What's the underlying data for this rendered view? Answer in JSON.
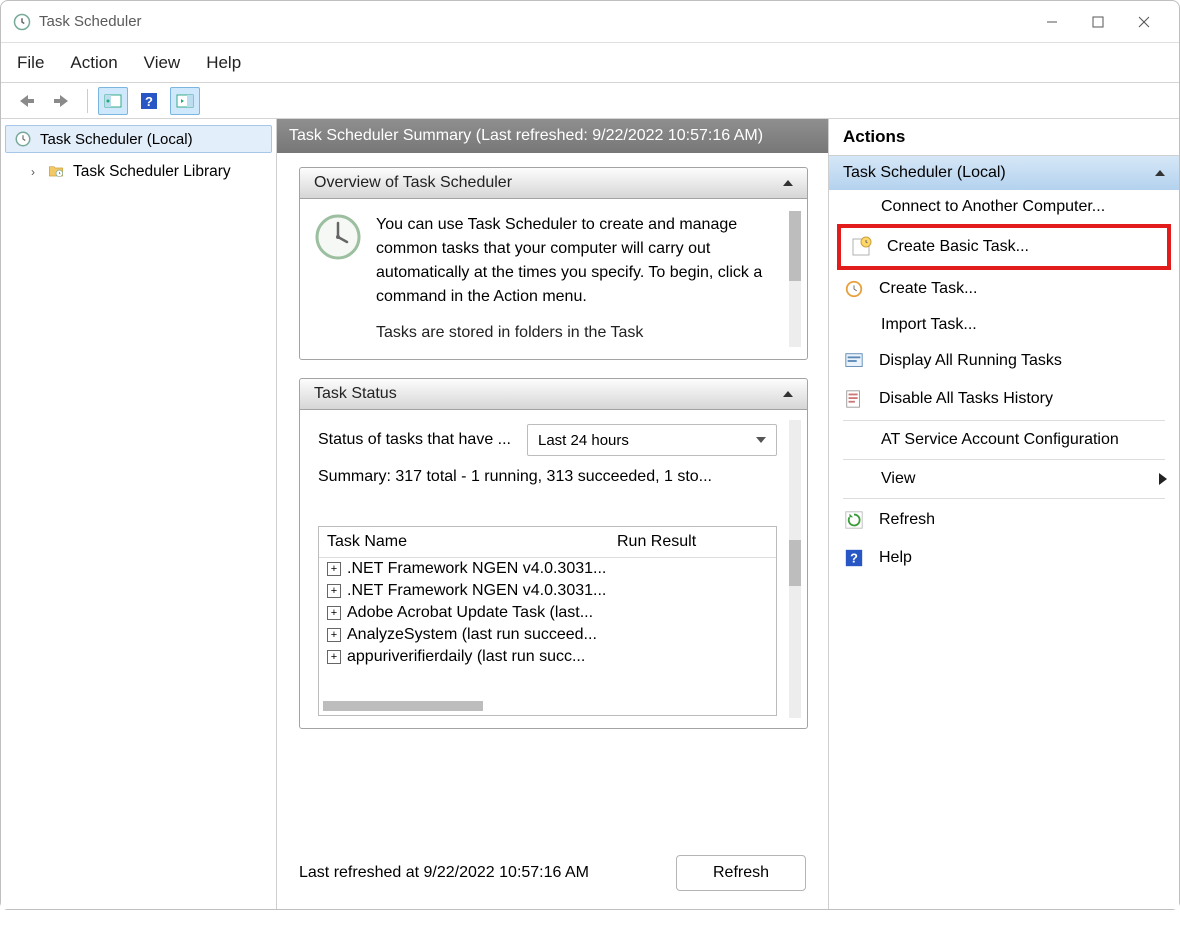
{
  "title": "Task Scheduler",
  "menubar": {
    "file": "File",
    "action": "Action",
    "view": "View",
    "help": "Help"
  },
  "nav": {
    "root": "Task Scheduler (Local)",
    "child": "Task Scheduler Library"
  },
  "summary": {
    "header": "Task Scheduler Summary (Last refreshed: 9/22/2022 10:57:16 AM)",
    "overview_title": "Overview of Task Scheduler",
    "overview_text1": "You can use Task Scheduler to create and manage common tasks that your computer will carry out automatically at the times you specify. To begin, click a command in the Action menu.",
    "overview_text2": "Tasks are stored in folders in the Task",
    "status_title": "Task Status",
    "status_label": "Status of tasks that have ...",
    "status_combo": "Last 24 hours",
    "status_summary": "Summary: 317 total - 1 running, 313 succeeded, 1 sto...",
    "task_col1": "Task Name",
    "task_col2": "Run Result",
    "tasks": [
      ".NET Framework NGEN v4.0.3031...",
      ".NET Framework NGEN v4.0.3031...",
      "Adobe Acrobat Update Task (last...",
      "AnalyzeSystem (last run succeed...",
      "appuriverifierdaily (last run succ..."
    ],
    "last_refreshed": "Last refreshed at 9/22/2022 10:57:16 AM",
    "refresh_btn": "Refresh"
  },
  "actions": {
    "title": "Actions",
    "group": "Task Scheduler (Local)",
    "items": {
      "connect": "Connect to Another Computer...",
      "create_basic": "Create Basic Task...",
      "create_task": "Create Task...",
      "import_task": "Import Task...",
      "display_running": "Display All Running Tasks",
      "disable_history": "Disable All Tasks History",
      "at_service": "AT Service Account Configuration",
      "view": "View",
      "refresh": "Refresh",
      "help": "Help"
    }
  }
}
